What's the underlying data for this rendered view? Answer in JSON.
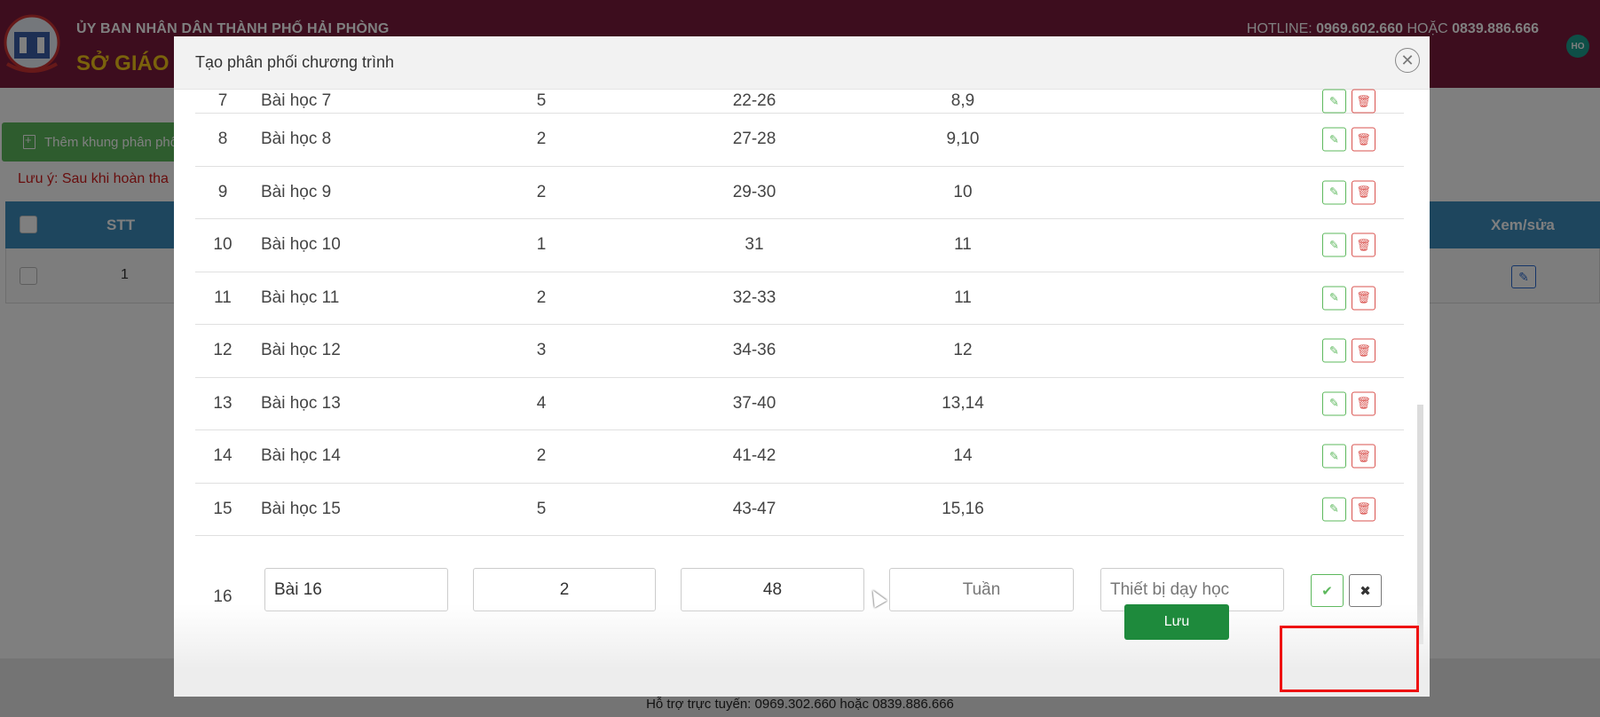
{
  "header": {
    "org_name": "ỦY BAN NHÂN DÂN THÀNH PHỐ HẢI PHÒNG",
    "dept_name": "SỞ GIÁO D",
    "hotline_label": "HOTLINE: ",
    "hotline_1": "0969.602.660",
    "hotline_or": " HOẶC ",
    "hotline_2": "0839.886.666",
    "avatar_initials": "HO"
  },
  "page": {
    "add_button_label": "Thêm khung phân phố",
    "note_text": "Lưu ý: Sau khi hoàn tha",
    "table_headers": {
      "stt": "STT",
      "edit": "Xem/sửa"
    },
    "rows": [
      {
        "stt": "1"
      }
    ]
  },
  "modal": {
    "title": "Tạo phân phối chương trình",
    "close_icon": "close-icon",
    "rows": [
      {
        "stt": "7",
        "name": "Bài học 7",
        "periods": "5",
        "tiet": "22-26",
        "tuan": "8,9"
      },
      {
        "stt": "8",
        "name": "Bài học 8",
        "periods": "2",
        "tiet": "27-28",
        "tuan": "9,10"
      },
      {
        "stt": "9",
        "name": "Bài học 9",
        "periods": "2",
        "tiet": "29-30",
        "tuan": "10"
      },
      {
        "stt": "10",
        "name": "Bài học 10",
        "periods": "1",
        "tiet": "31",
        "tuan": "11"
      },
      {
        "stt": "11",
        "name": "Bài học 11",
        "periods": "2",
        "tiet": "32-33",
        "tuan": "11"
      },
      {
        "stt": "12",
        "name": "Bài học 12",
        "periods": "3",
        "tiet": "34-36",
        "tuan": "12"
      },
      {
        "stt": "13",
        "name": "Bài học 13",
        "periods": "4",
        "tiet": "37-40",
        "tuan": "13,14"
      },
      {
        "stt": "14",
        "name": "Bài học 14",
        "periods": "2",
        "tiet": "41-42",
        "tuan": "14"
      },
      {
        "stt": "15",
        "name": "Bài học 15",
        "periods": "5",
        "tiet": "43-47",
        "tuan": "15,16"
      }
    ],
    "new_row": {
      "stt": "16",
      "name_value": "Bài 16",
      "periods_value": "2",
      "tiet_value": "48",
      "tuan_placeholder": "Tuần",
      "equipment_placeholder": "Thiết bị dạy học"
    },
    "save_label": "Lưu"
  },
  "footer": {
    "support_text": "Hỗ trợ trực tuyến: 0969.302.660 hoặc 0839.886.666"
  },
  "colors": {
    "brand": "#7a1a3c",
    "table_head": "#3c8dbc",
    "save": "#1e8a3c",
    "highlight": "#ee1111"
  }
}
